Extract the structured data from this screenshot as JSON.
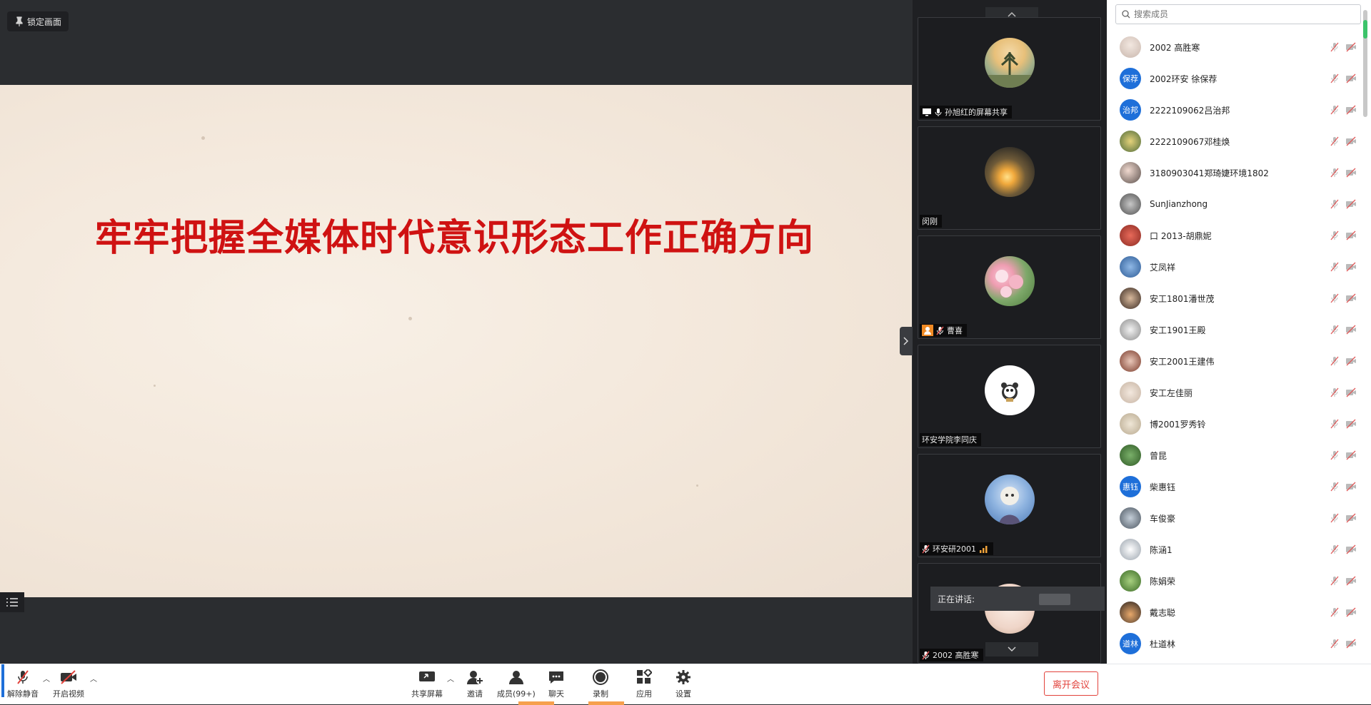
{
  "stage": {
    "pin_label": "锁定画面",
    "slide_title": "牢牢把握全媒体时代意识形态工作正确方向"
  },
  "video_tiles": [
    {
      "name": "孙旭红的屏幕共享"
    },
    {
      "name": "闵刚"
    },
    {
      "name": "曹喜"
    },
    {
      "name": "环安学院李同庆"
    },
    {
      "name": "环安研2001"
    },
    {
      "name": "2002 高胜寒"
    }
  ],
  "speaking_label": "正在讲话:",
  "member_panel": {
    "search_placeholder": "搜索成员",
    "members": [
      {
        "name": "2002 高胜寒"
      },
      {
        "name": "2002环安 徐保荐",
        "avatar_text": "保荐"
      },
      {
        "name": "2222109062吕治邦",
        "avatar_text": "治邦"
      },
      {
        "name": "2222109067邓桂焕"
      },
      {
        "name": "3180903041郑琦婕环境1802"
      },
      {
        "name": "SunJianzhong"
      },
      {
        "name": "口 2013-胡鼎妮"
      },
      {
        "name": "艾凤祥"
      },
      {
        "name": "安工1801潘世茂"
      },
      {
        "name": "安工1901王殿"
      },
      {
        "name": "安工2001王建伟"
      },
      {
        "name": "安工左佳丽"
      },
      {
        "name": "博2001罗秀铃"
      },
      {
        "name": "曾昆"
      },
      {
        "name": "柴惠钰",
        "avatar_text": "惠钰"
      },
      {
        "name": "车俊豪"
      },
      {
        "name": "陈涵1"
      },
      {
        "name": "陈娟荣"
      },
      {
        "name": "戴志聪"
      },
      {
        "name": "杜道林",
        "avatar_text": "道林"
      }
    ]
  },
  "toolbar": {
    "unmute": "解除静音",
    "start_video": "开启视频",
    "share_screen": "共享屏幕",
    "invite": "邀请",
    "members": "成员(99+)",
    "chat": "聊天",
    "record": "录制",
    "apps": "应用",
    "settings": "设置",
    "leave": "离开会议"
  },
  "colors": {
    "slide_title": "#cf1212",
    "accent_blue": "#1e6fd9",
    "leave_red": "#e2423b",
    "muted_red": "#e05a5a"
  }
}
